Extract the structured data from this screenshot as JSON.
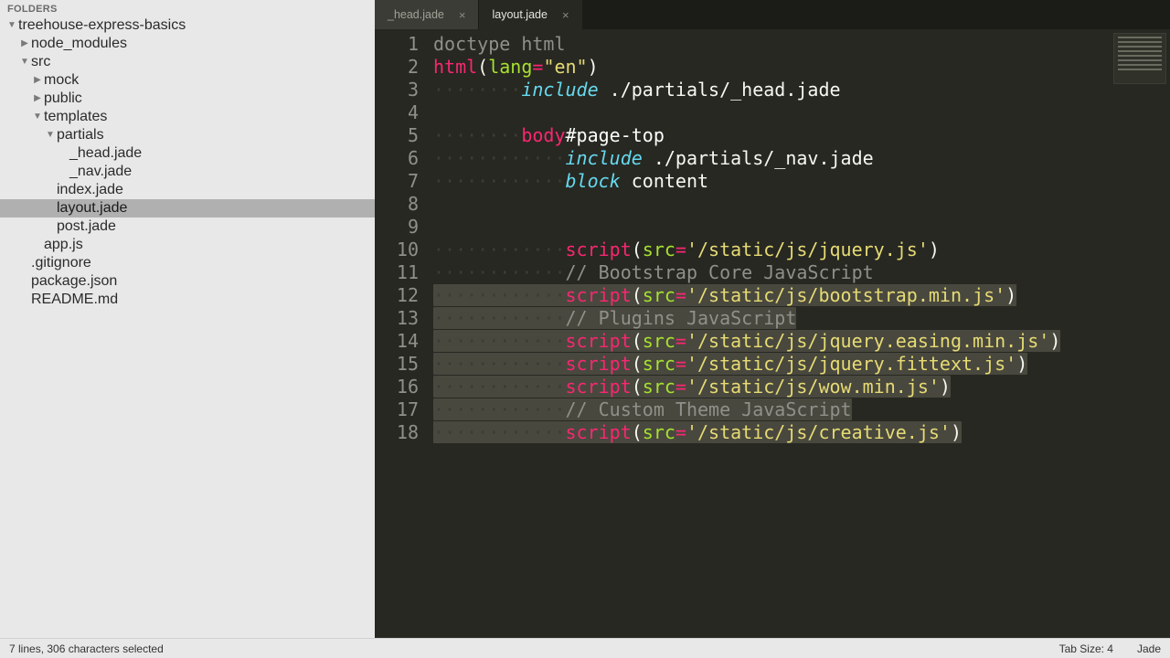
{
  "sidebar": {
    "header": "FOLDERS",
    "tree": [
      {
        "label": "treehouse-express-basics",
        "indent": 0,
        "arrow": "down",
        "folder": true
      },
      {
        "label": "node_modules",
        "indent": 1,
        "arrow": "right",
        "folder": true
      },
      {
        "label": "src",
        "indent": 1,
        "arrow": "down",
        "folder": true
      },
      {
        "label": "mock",
        "indent": 2,
        "arrow": "right",
        "folder": true
      },
      {
        "label": "public",
        "indent": 2,
        "arrow": "right",
        "folder": true
      },
      {
        "label": "templates",
        "indent": 2,
        "arrow": "down",
        "folder": true
      },
      {
        "label": "partials",
        "indent": 3,
        "arrow": "down",
        "folder": true
      },
      {
        "label": "_head.jade",
        "indent": 4,
        "arrow": "",
        "folder": false
      },
      {
        "label": "_nav.jade",
        "indent": 4,
        "arrow": "",
        "folder": false
      },
      {
        "label": "index.jade",
        "indent": 3,
        "arrow": "",
        "folder": false
      },
      {
        "label": "layout.jade",
        "indent": 3,
        "arrow": "",
        "folder": false,
        "selected": true
      },
      {
        "label": "post.jade",
        "indent": 3,
        "arrow": "",
        "folder": false
      },
      {
        "label": "app.js",
        "indent": 2,
        "arrow": "",
        "folder": false
      },
      {
        "label": ".gitignore",
        "indent": 1,
        "arrow": "",
        "folder": false
      },
      {
        "label": "package.json",
        "indent": 1,
        "arrow": "",
        "folder": false
      },
      {
        "label": "README.md",
        "indent": 1,
        "arrow": "",
        "folder": false
      }
    ]
  },
  "tabs": [
    {
      "label": "_head.jade",
      "active": false
    },
    {
      "label": "layout.jade",
      "active": true
    }
  ],
  "code_lines": [
    [
      {
        "t": "doctype",
        "v": "doctype html"
      }
    ],
    [
      {
        "t": "key",
        "v": "html"
      },
      {
        "t": "paren",
        "v": "("
      },
      {
        "t": "attr",
        "v": "lang"
      },
      {
        "t": "eq",
        "v": "="
      },
      {
        "t": "str",
        "v": "\"en\""
      },
      {
        "t": "paren",
        "v": ")"
      }
    ],
    [
      {
        "t": "pad",
        "v": "        "
      },
      {
        "t": "include",
        "v": "include"
      },
      {
        "t": "plain",
        "v": " ./partials/_head.jade"
      }
    ],
    [],
    [
      {
        "t": "pad",
        "v": "        "
      },
      {
        "t": "key",
        "v": "body"
      },
      {
        "t": "id",
        "v": "#page-top"
      }
    ],
    [
      {
        "t": "pad",
        "v": "            "
      },
      {
        "t": "include",
        "v": "include"
      },
      {
        "t": "plain",
        "v": " ./partials/_nav.jade"
      }
    ],
    [
      {
        "t": "pad",
        "v": "            "
      },
      {
        "t": "include",
        "v": "block"
      },
      {
        "t": "plain",
        "v": " content"
      }
    ],
    [],
    [],
    [
      {
        "t": "pad",
        "v": "            "
      },
      {
        "t": "key",
        "v": "script"
      },
      {
        "t": "paren",
        "v": "("
      },
      {
        "t": "attr",
        "v": "src"
      },
      {
        "t": "eq",
        "v": "="
      },
      {
        "t": "str",
        "v": "'/static/js/jquery.js'"
      },
      {
        "t": "paren",
        "v": ")"
      }
    ],
    [
      {
        "t": "pad",
        "v": "            "
      },
      {
        "t": "comment",
        "v": "// Bootstrap Core JavaScript"
      }
    ],
    [
      {
        "t": "pad",
        "v": "            "
      },
      {
        "t": "key",
        "v": "script"
      },
      {
        "t": "paren",
        "v": "("
      },
      {
        "t": "attr",
        "v": "src"
      },
      {
        "t": "eq",
        "v": "="
      },
      {
        "t": "str",
        "v": "'/static/js/bootstrap.min.js'"
      },
      {
        "t": "paren",
        "v": ")"
      }
    ],
    [
      {
        "t": "pad",
        "v": "            "
      },
      {
        "t": "comment",
        "v": "// Plugins JavaScript"
      }
    ],
    [
      {
        "t": "pad",
        "v": "            "
      },
      {
        "t": "key",
        "v": "script"
      },
      {
        "t": "paren",
        "v": "("
      },
      {
        "t": "attr",
        "v": "src"
      },
      {
        "t": "eq",
        "v": "="
      },
      {
        "t": "str",
        "v": "'/static/js/jquery.easing.min.js'"
      },
      {
        "t": "paren",
        "v": ")"
      }
    ],
    [
      {
        "t": "pad",
        "v": "            "
      },
      {
        "t": "key",
        "v": "script"
      },
      {
        "t": "paren",
        "v": "("
      },
      {
        "t": "attr",
        "v": "src"
      },
      {
        "t": "eq",
        "v": "="
      },
      {
        "t": "str",
        "v": "'/static/js/jquery.fittext.js'"
      },
      {
        "t": "paren",
        "v": ")"
      }
    ],
    [
      {
        "t": "pad",
        "v": "            "
      },
      {
        "t": "key",
        "v": "script"
      },
      {
        "t": "paren",
        "v": "("
      },
      {
        "t": "attr",
        "v": "src"
      },
      {
        "t": "eq",
        "v": "="
      },
      {
        "t": "str",
        "v": "'/static/js/wow.min.js'"
      },
      {
        "t": "paren",
        "v": ")"
      }
    ],
    [
      {
        "t": "pad",
        "v": "            "
      },
      {
        "t": "comment",
        "v": "// Custom Theme JavaScript"
      }
    ],
    [
      {
        "t": "pad",
        "v": "            "
      },
      {
        "t": "key",
        "v": "script"
      },
      {
        "t": "paren",
        "v": "("
      },
      {
        "t": "attr",
        "v": "src"
      },
      {
        "t": "eq",
        "v": "="
      },
      {
        "t": "str",
        "v": "'/static/js/creative.js'"
      },
      {
        "t": "paren",
        "v": ")"
      }
    ]
  ],
  "selection_lines": [
    12,
    13,
    14,
    15,
    16,
    17,
    18
  ],
  "statusbar": {
    "left": "7 lines, 306 characters selected",
    "tab_size": "Tab Size: 4",
    "syntax": "Jade"
  }
}
